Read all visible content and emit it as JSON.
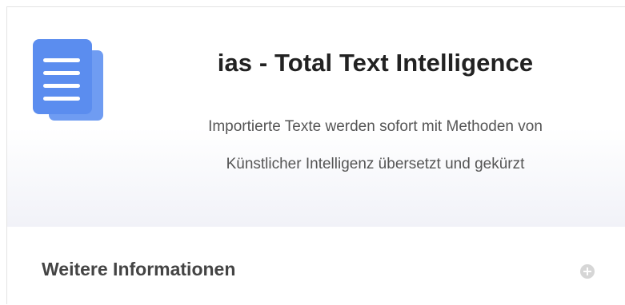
{
  "product": {
    "title": "ias - Total Text Intelligence",
    "description_lines": [
      "Importierte Texte werden sofort mit Methoden von",
      "Künstlicher Intelligenz übersetzt und gekürzt"
    ],
    "icon": "document-stack-icon",
    "accent_color": "#5b8def"
  },
  "more_info": {
    "label": "Weitere Informationen",
    "icon": "plus-circle-icon"
  }
}
